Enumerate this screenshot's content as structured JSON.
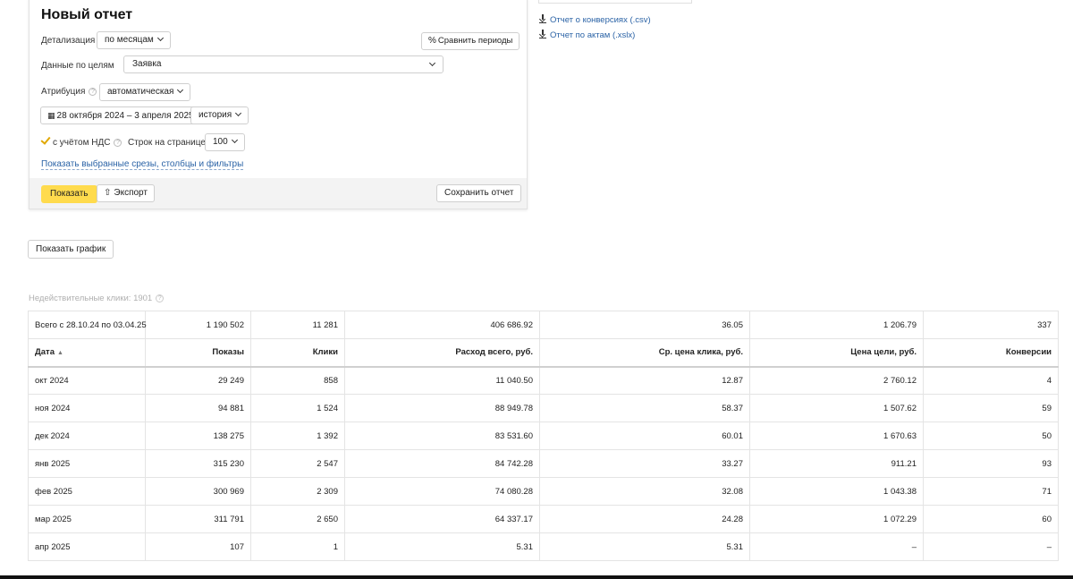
{
  "report": {
    "title": "Новый отчет",
    "detail_label": "Детализация",
    "detail_value": "по месяцам",
    "compare_label": "Сравнить периоды",
    "goals_label": "Данные по целям",
    "goals_value": "Заявка",
    "attribution_label": "Атрибуция",
    "attribution_value": "автоматическая",
    "date_range": "28 октября 2024 – 3 апреля 2025",
    "history_value": "история",
    "vat_label": "с учётом НДС",
    "rows_label": "Строк на странице",
    "rows_value": "100",
    "show_filters_link": "Показать выбранные срезы, столбцы и фильтры",
    "show_button": "Показать",
    "export_button": "Экспорт",
    "save_button": "Сохранить отчет"
  },
  "downloads": {
    "conversions_csv": "Отчет о конверсиях (.csv)",
    "acts_xlsx": "Отчет по актам (.xslx)"
  },
  "chart_button": "Показать график",
  "invalid_clicks": "Недействительные клики: 1901",
  "icons": {
    "compare": "compare-icon",
    "calendar": "calendar-icon",
    "export": "upload-icon",
    "download": "download-icon",
    "help": "question-circle-icon"
  },
  "colors": {
    "accent": "#ffdb4d",
    "link": "#2b63a6",
    "brand_red": "#e6322b",
    "check": "#e0a800"
  },
  "table": {
    "totals": [
      "Всего с 28.10.24 по 03.04.25",
      "1 190 502",
      "11 281",
      "406 686.92",
      "36.05",
      "1 206.79",
      "337"
    ],
    "headers": [
      "Дата",
      "Показы",
      "Клики",
      "Расход всего, руб.",
      "Ср. цена клика, руб.",
      "Цена цели, руб.",
      "Конверсии"
    ],
    "sort_indicator": "▲",
    "rows": [
      [
        "окт 2024",
        "29 249",
        "858",
        "11 040.50",
        "12.87",
        "2 760.12",
        "4"
      ],
      [
        "ноя 2024",
        "94 881",
        "1 524",
        "88 949.78",
        "58.37",
        "1 507.62",
        "59"
      ],
      [
        "дек 2024",
        "138 275",
        "1 392",
        "83 531.60",
        "60.01",
        "1 670.63",
        "50"
      ],
      [
        "янв 2025",
        "315 230",
        "2 547",
        "84 742.28",
        "33.27",
        "911.21",
        "93"
      ],
      [
        "фев 2025",
        "300 969",
        "2 309",
        "74 080.28",
        "32.08",
        "1 043.38",
        "71"
      ],
      [
        "мар 2025",
        "311 791",
        "2 650",
        "64 337.17",
        "24.28",
        "1 072.29",
        "60"
      ],
      [
        "апр 2025",
        "107",
        "1",
        "5.31",
        "5.31",
        "–",
        "–"
      ]
    ]
  }
}
